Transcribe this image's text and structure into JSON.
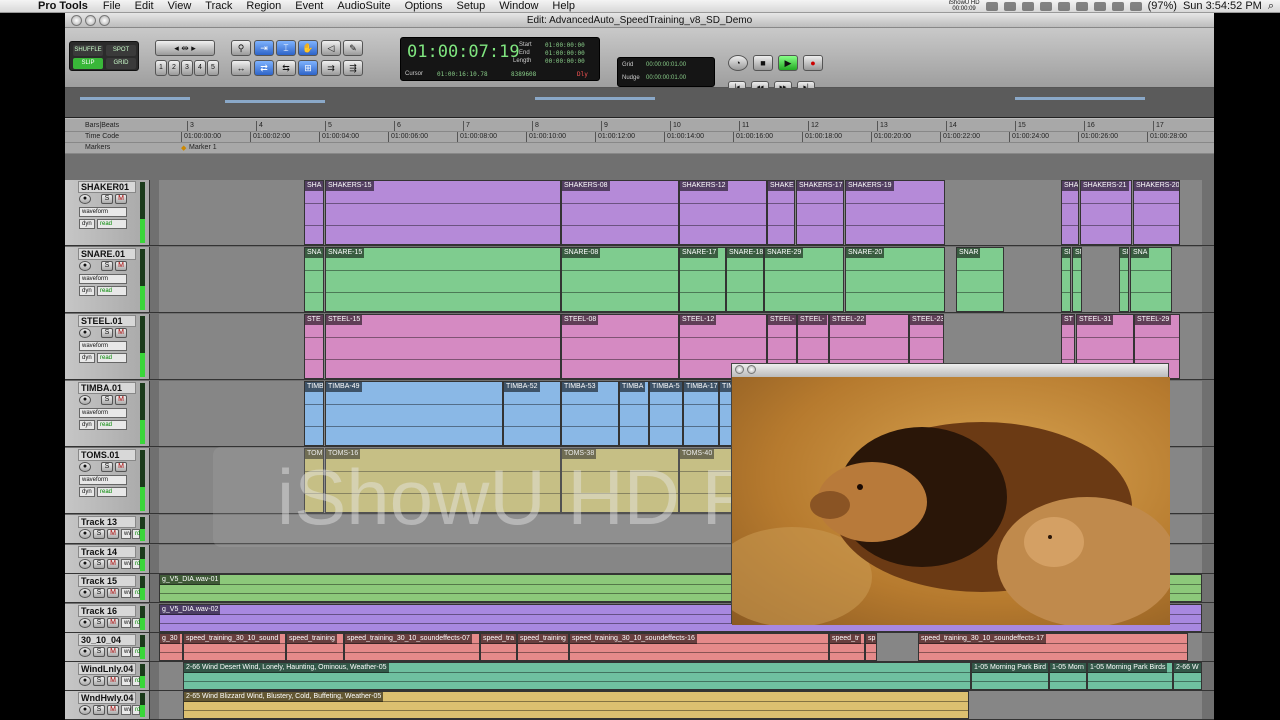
{
  "menubar": {
    "app": "Pro Tools",
    "items": [
      "File",
      "Edit",
      "View",
      "Track",
      "Region",
      "Event",
      "AudioSuite",
      "Options",
      "Setup",
      "Window",
      "Help"
    ],
    "status_app": "iShowU HD",
    "status_time_small": "00:00:09",
    "battery": "(97%)",
    "clock": "Sun 3:54:52 PM"
  },
  "window": {
    "title": "Edit: AdvancedAuto_SpeedTraining_v8_SD_Demo"
  },
  "edit_modes": {
    "shuffle": "SHUFFLE",
    "spot": "SPOT",
    "slip": "SLIP",
    "grid": "GRID"
  },
  "zoom_presets": [
    "1",
    "2",
    "3",
    "4",
    "5"
  ],
  "counter": {
    "main": "01:00:07:19",
    "start_label": "Start",
    "start": "01:00:00:00",
    "end_label": "End",
    "end": "01:00:00:00",
    "length_label": "Length",
    "length": "00:00:00:00",
    "cursor_label": "Cursor",
    "cursor": "01:00:16:10.78",
    "samples": "8389608",
    "dly": "Dly"
  },
  "grid": {
    "grid_label": "Grid",
    "grid_value": "00:00:00:01.00",
    "nudge_label": "Nudge",
    "nudge_value": "00:00:00:01.00"
  },
  "rulers": {
    "bars_label": "Bars|Beats",
    "timecode_label": "Time Code",
    "markers_label": "Markers",
    "marker_name": "Marker 1",
    "bars": [
      "3",
      "4",
      "5",
      "6",
      "7",
      "8",
      "9",
      "10",
      "11",
      "12",
      "13",
      "14",
      "15",
      "16",
      "17"
    ],
    "timecodes": [
      "01:00:00:00",
      "01:00:02:00",
      "01:00:04:00",
      "01:00:06:00",
      "01:00:08:00",
      "01:00:10:00",
      "01:00:12:00",
      "01:00:14:00",
      "01:00:16:00",
      "01:00:18:00",
      "01:00:20:00",
      "01:00:22:00",
      "01:00:24:00",
      "01:00:26:00",
      "01:00:28:00"
    ]
  },
  "header_controls": {
    "solo": "S",
    "mute": "M",
    "waveform": "waveform",
    "dyn": "dyn",
    "read": "read",
    "wv": "wv",
    "rd": "rd"
  },
  "tracks": [
    {
      "name": "SHAKER01",
      "color": "#b58ad8",
      "clips": [
        {
          "n": "SHA"
        },
        {
          "n": "SHAKERS-15"
        },
        {
          "n": "SHAKERS-08"
        },
        {
          "n": "SHAKERS-12"
        },
        {
          "n": "SHAKE"
        },
        {
          "n": "SHAKERS-17"
        },
        {
          "n": "SHAKERS-19"
        },
        {
          "n": "SHA"
        },
        {
          "n": "SHAKERS-21"
        },
        {
          "n": "SHAKERS-20"
        }
      ]
    },
    {
      "name": "SNARE.01",
      "color": "#7fcc8f",
      "clips": [
        {
          "n": "SNA"
        },
        {
          "n": "SNARE-15"
        },
        {
          "n": "SNARE-08"
        },
        {
          "n": "SNARE-17"
        },
        {
          "n": "SNARE-18"
        },
        {
          "n": "SNARE-29"
        },
        {
          "n": "SNARE-20"
        },
        {
          "n": "SNAR"
        },
        {
          "n": "SN"
        },
        {
          "n": "SN"
        },
        {
          "n": "SN"
        },
        {
          "n": "SNA"
        }
      ]
    },
    {
      "name": "STEEL.01",
      "color": "#d58ac2",
      "clips": [
        {
          "n": "STE"
        },
        {
          "n": "STEEL-15"
        },
        {
          "n": "STEEL-08"
        },
        {
          "n": "STEEL-12"
        },
        {
          "n": "STEEL-"
        },
        {
          "n": "STEEL-"
        },
        {
          "n": "STEEL-22"
        },
        {
          "n": "STEEL-23"
        },
        {
          "n": "ST"
        },
        {
          "n": "STEEL-31"
        },
        {
          "n": "STEEL-29"
        }
      ]
    },
    {
      "name": "TIMBA.01",
      "color": "#8ab8e6",
      "clips": [
        {
          "n": "TIMB"
        },
        {
          "n": "TIMBA-49"
        },
        {
          "n": "TIMBA-52"
        },
        {
          "n": "TIMBA-53"
        },
        {
          "n": "TIMBA"
        },
        {
          "n": "TIMBA-5"
        },
        {
          "n": "TIMBA-17"
        },
        {
          "n": "TIMB"
        }
      ]
    },
    {
      "name": "TOMS.01",
      "color": "#cfc678",
      "clips": [
        {
          "n": "TOM"
        },
        {
          "n": "TOMS-16"
        },
        {
          "n": "TOMS-38"
        },
        {
          "n": "TOMS-40"
        }
      ]
    },
    {
      "name": "Track 13",
      "clips": []
    },
    {
      "name": "Track 14",
      "clips": []
    },
    {
      "name": "Track 15",
      "color": "#8cc87a",
      "clips": [
        {
          "n": "g_V5_DIA.wav-01"
        }
      ]
    },
    {
      "name": "Track 16",
      "color": "#a888e0",
      "clips": [
        {
          "n": "g_V5_DIA.wav-02"
        }
      ]
    },
    {
      "name": "30_10_04",
      "color": "#e58a8a",
      "clips": [
        {
          "n": "g_30"
        },
        {
          "n": "speed_training_30_10_sound"
        },
        {
          "n": "speed_training"
        },
        {
          "n": "speed_training_30_10_soundeffects-07"
        },
        {
          "n": "speed_tra"
        },
        {
          "n": "speed_training"
        },
        {
          "n": "speed_training_30_10_soundeffects-16"
        },
        {
          "n": "speed_tr"
        },
        {
          "n": "sp"
        },
        {
          "n": "speed_training_30_10_soundeffects-17"
        }
      ]
    },
    {
      "name": "WindLnly.04",
      "color": "#6fc0a0",
      "clips": [
        {
          "n": "2-66 Wind Desert Wind, Lonely, Haunting, Ominous, Weather-05"
        },
        {
          "n": "1-05 Morning Park Bird"
        },
        {
          "n": "1-05 Morn"
        },
        {
          "n": "1-05 Morning Park Birds"
        },
        {
          "n": "2-66 W"
        }
      ]
    },
    {
      "name": "WndHwly.04",
      "color": "#dcc070",
      "clips": [
        {
          "n": "2-65 Wind Blizzard Wind, Blustery, Cold, Buffeting, Weather-05"
        }
      ]
    }
  ],
  "watermark": "iShowU HD Preview",
  "colors": {
    "counter_green": "#7fe57f",
    "mode_active": "#39b739",
    "tool_active": "#2e64c8"
  }
}
